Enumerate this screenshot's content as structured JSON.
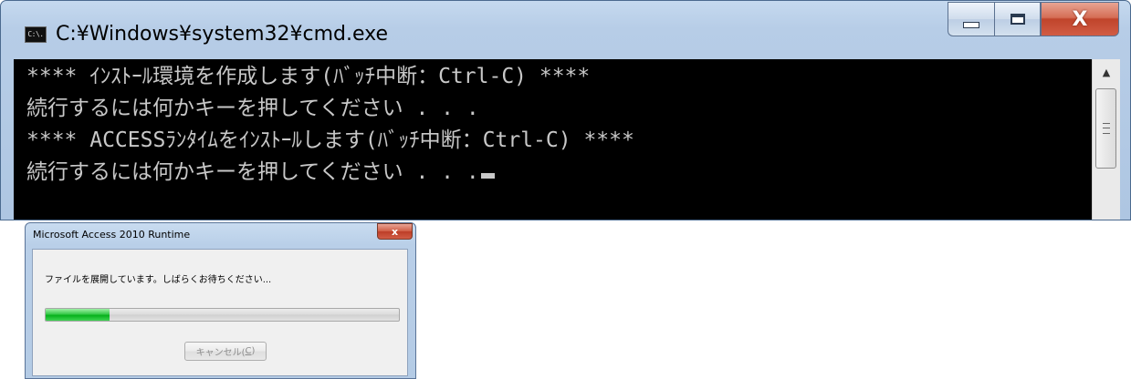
{
  "cmd": {
    "title": "C:¥Windows¥system32¥cmd.exe",
    "icon_text": "C:\\.",
    "lines": [
      "**** ｲﾝｽﾄｰﾙ環境を作成します(ﾊﾞｯﾁ中断：Ctrl-C) ****",
      "続行するには何かキーを押してください . . .",
      "**** ACCESSﾗﾝﾀｲﾑをｲﾝｽﾄｰﾙします(ﾊﾞｯﾁ中断：Ctrl-C) ****",
      "続行するには何かキーを押してください . . ."
    ],
    "close_glyph": "X"
  },
  "dialog": {
    "title": "Microsoft Access 2010 Runtime",
    "message": "ファイルを展開しています。しばらくお待ちください...",
    "progress_fraction": 0.18,
    "cancel_label_prefix": "キャンセル(",
    "cancel_mnemonic": "C",
    "cancel_label_suffix": ")",
    "close_glyph": "x"
  },
  "colors": {
    "console_bg": "#000000",
    "console_text": "#c8c8c8",
    "progress_green": "#07b11c"
  }
}
